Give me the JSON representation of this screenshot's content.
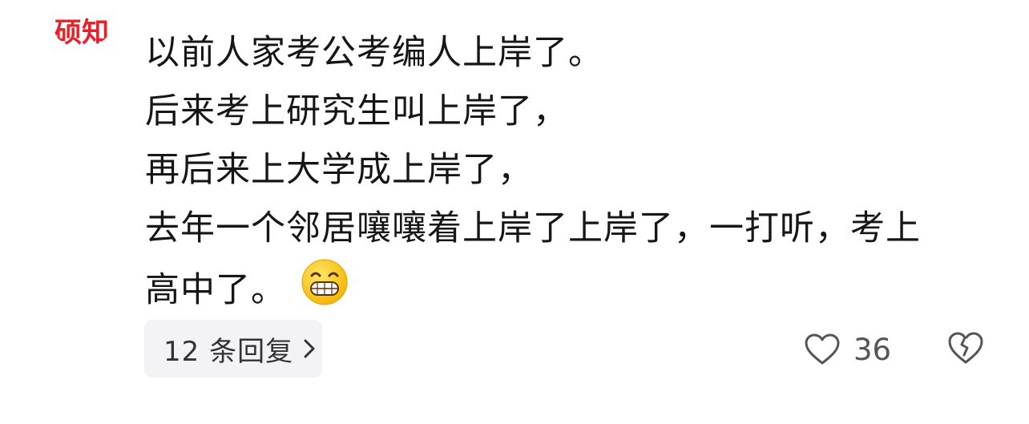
{
  "comment": {
    "lines": [
      "以前人家考公考编人上岸了。",
      "后来考上研究生叫上岸了，",
      "再后来上大学成上岸了，",
      "去年一个邻居嚷嚷着上岸了上岸了，一打听，考上",
      "高中了。"
    ],
    "emoji_icon": "grinning-face-emoji"
  },
  "avatar": {
    "icon": "avatar-logo",
    "text": "硕知"
  },
  "actions": {
    "replies_label": "12 条回复",
    "like_count": "36",
    "like_icon": "heart-outline-icon",
    "dislike_icon": "broken-heart-icon"
  },
  "colors": {
    "avatar_red": "#e8202a",
    "button_bg": "#f3f3f5",
    "text": "#161616",
    "icon_gray": "#555555"
  }
}
